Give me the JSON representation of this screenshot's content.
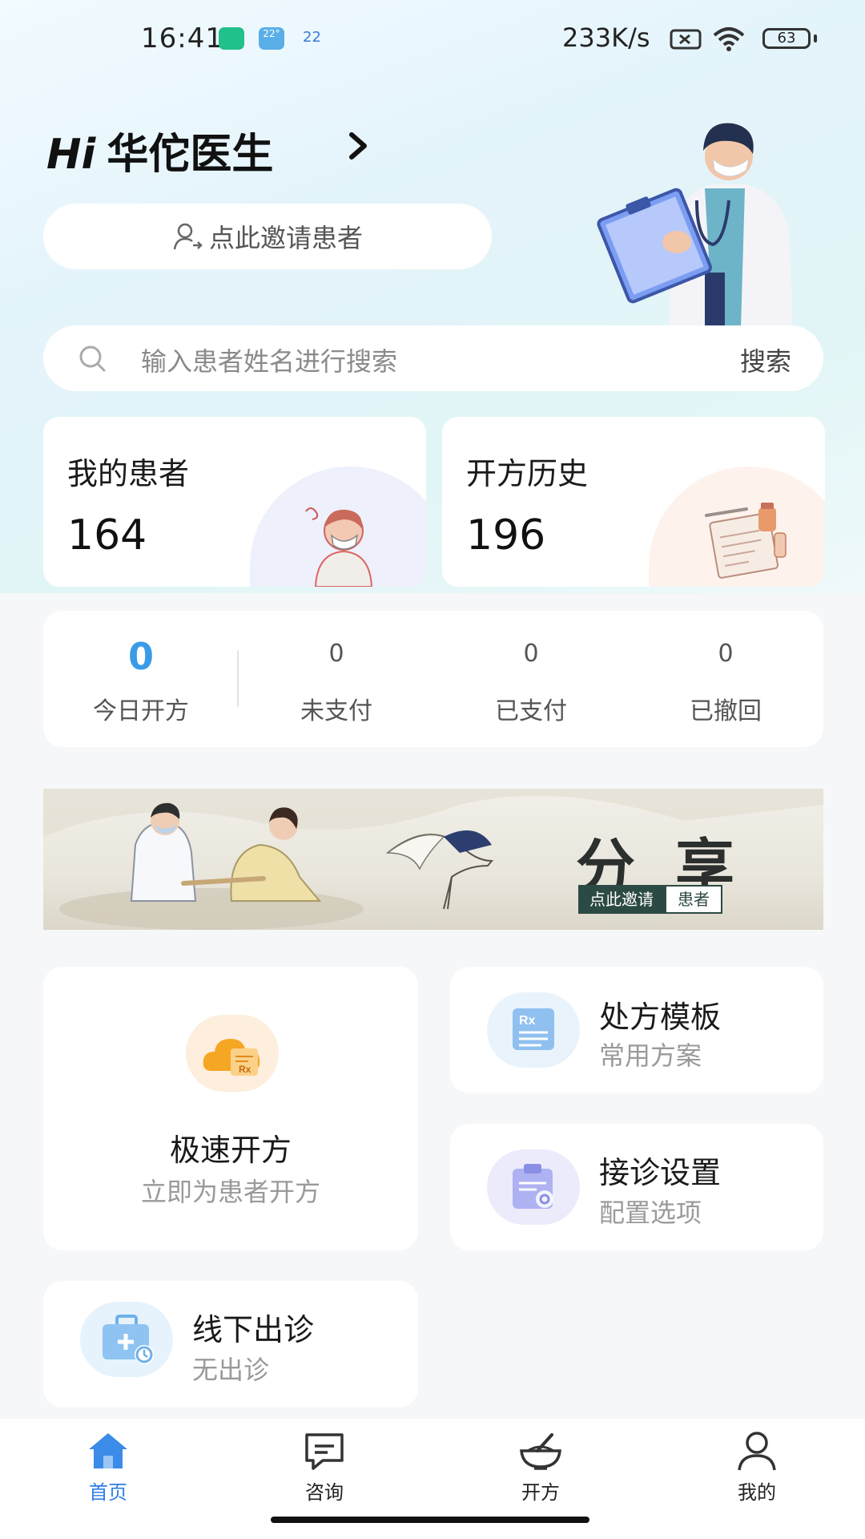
{
  "status_bar": {
    "time": "16:41",
    "weather_temp": "22°",
    "aqi_value": "22",
    "network_speed": "233K/s",
    "battery": "63"
  },
  "greeting": {
    "hi": "Hi",
    "name": "华佗医生"
  },
  "invite": {
    "label": "点此邀请患者"
  },
  "search": {
    "placeholder": "输入患者姓名进行搜索",
    "button_label": "搜索"
  },
  "stats": {
    "my_patients": {
      "label": "我的患者",
      "value": "164"
    },
    "rx_history": {
      "label": "开方历史",
      "value": "196"
    }
  },
  "counts": [
    {
      "label": "今日开方",
      "value": "0"
    },
    {
      "label": "未支付",
      "value": "0"
    },
    {
      "label": "已支付",
      "value": "0"
    },
    {
      "label": "已撤回",
      "value": "0"
    }
  ],
  "banner": {
    "title": "分享",
    "tag_left": "点此邀请",
    "tag_right": "患者"
  },
  "actions": {
    "quick_rx": {
      "title": "极速开方",
      "subtitle": "立即为患者开方"
    },
    "rx_template": {
      "title": "处方模板",
      "subtitle": "常用方案"
    },
    "consult_settings": {
      "title": "接诊设置",
      "subtitle": "配置选项"
    },
    "offline_clinic": {
      "title": "线下出诊",
      "subtitle": "无出诊"
    }
  },
  "tabs": [
    {
      "label": "首页",
      "icon": "home-icon",
      "active": true
    },
    {
      "label": "咨询",
      "icon": "chat-icon",
      "active": false
    },
    {
      "label": "开方",
      "icon": "mortar-bowl-icon",
      "active": false
    },
    {
      "label": "我的",
      "icon": "profile-icon",
      "active": false
    }
  ],
  "colors": {
    "accent": "#2f7fe6",
    "count_highlight": "#3a9be8",
    "banner_tag": "#2c4a44"
  }
}
